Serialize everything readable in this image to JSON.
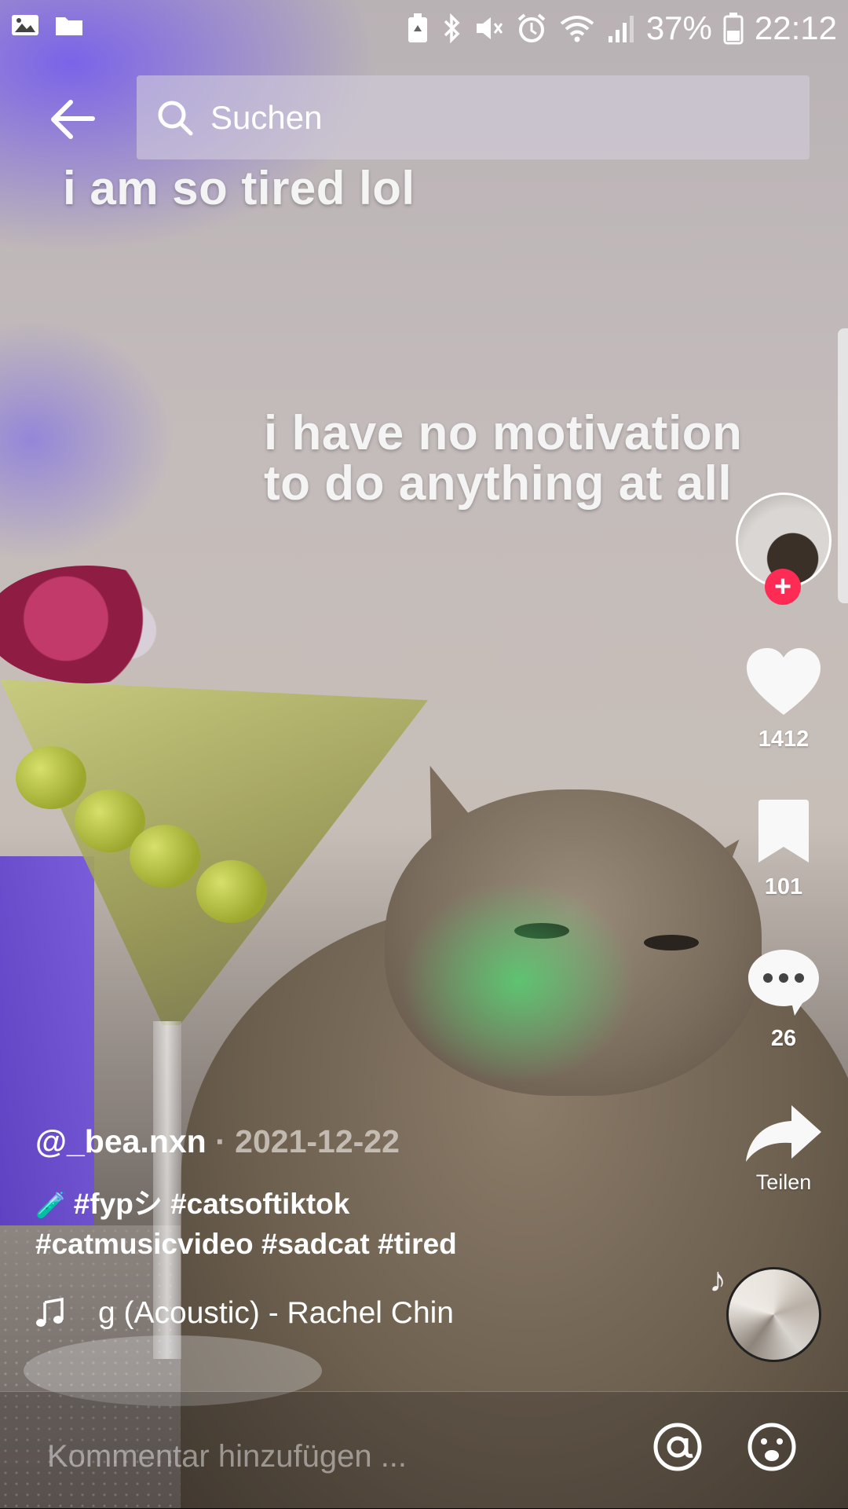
{
  "status_bar": {
    "battery": "37%",
    "time": "22:12"
  },
  "search": {
    "placeholder": "Suchen"
  },
  "video": {
    "overlay_text_1": "i am so tired lol",
    "overlay_text_2_line1": "i have no motivation",
    "overlay_text_2_line2": "to do anything at all"
  },
  "actions": {
    "likes": "1412",
    "bookmarks": "101",
    "comments": "26",
    "share_label": "Teilen"
  },
  "post": {
    "username": "@_bea.nxn",
    "separator": " · ",
    "date": "2021-12-22",
    "caption_line1": "#fypシ #catsoftiktok",
    "caption_line2": "#catmusicvideo #sadcat #tired",
    "sound": "g (Acoustic) - Rachel Chin"
  },
  "comment_bar": {
    "placeholder": "Kommentar hinzufügen ..."
  },
  "icons": [
    "gallery-icon",
    "folder-icon",
    "battery-saver-icon",
    "bluetooth-icon",
    "mute-icon",
    "alarm-icon",
    "wifi-icon",
    "signal-icon",
    "battery-icon",
    "back-arrow-icon",
    "search-icon",
    "heart-icon",
    "bookmark-icon",
    "comment-icon",
    "share-icon",
    "music-note-icon",
    "mention-icon",
    "emoji-icon"
  ]
}
